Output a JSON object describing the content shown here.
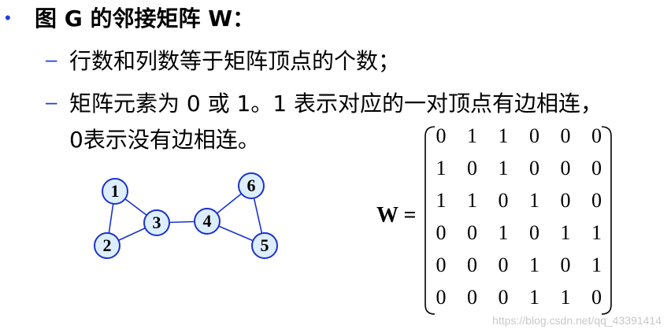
{
  "heading": "图 G 的邻接矩阵 W：",
  "bullet_symbol": "•",
  "dash_symbol": "–",
  "line1": "行数和列数等于矩阵顶点的个数；",
  "line2": "矩阵元素为 0 或 1。1 表示对应的一对顶点有边相连，",
  "line3": "0表示没有边相连。",
  "graph": {
    "nodes": [
      "1",
      "2",
      "3",
      "4",
      "5",
      "6"
    ],
    "edges": [
      [
        "1",
        "2"
      ],
      [
        "1",
        "3"
      ],
      [
        "2",
        "3"
      ],
      [
        "3",
        "4"
      ],
      [
        "4",
        "5"
      ],
      [
        "4",
        "6"
      ],
      [
        "5",
        "6"
      ]
    ],
    "node_fill": "#ddeeff",
    "node_stroke": "#1a33cc",
    "edge_color": "#1a33cc"
  },
  "matrix_label": "W =",
  "matrix": [
    [
      "0",
      "1",
      "1",
      "0",
      "0",
      "0"
    ],
    [
      "1",
      "0",
      "1",
      "0",
      "0",
      "0"
    ],
    [
      "1",
      "1",
      "0",
      "1",
      "0",
      "0"
    ],
    [
      "0",
      "0",
      "1",
      "0",
      "1",
      "1"
    ],
    [
      "0",
      "0",
      "0",
      "1",
      "0",
      "1"
    ],
    [
      "0",
      "0",
      "0",
      "1",
      "1",
      "0"
    ]
  ],
  "watermark": "https://blog.csdn.net/qq_43391414"
}
